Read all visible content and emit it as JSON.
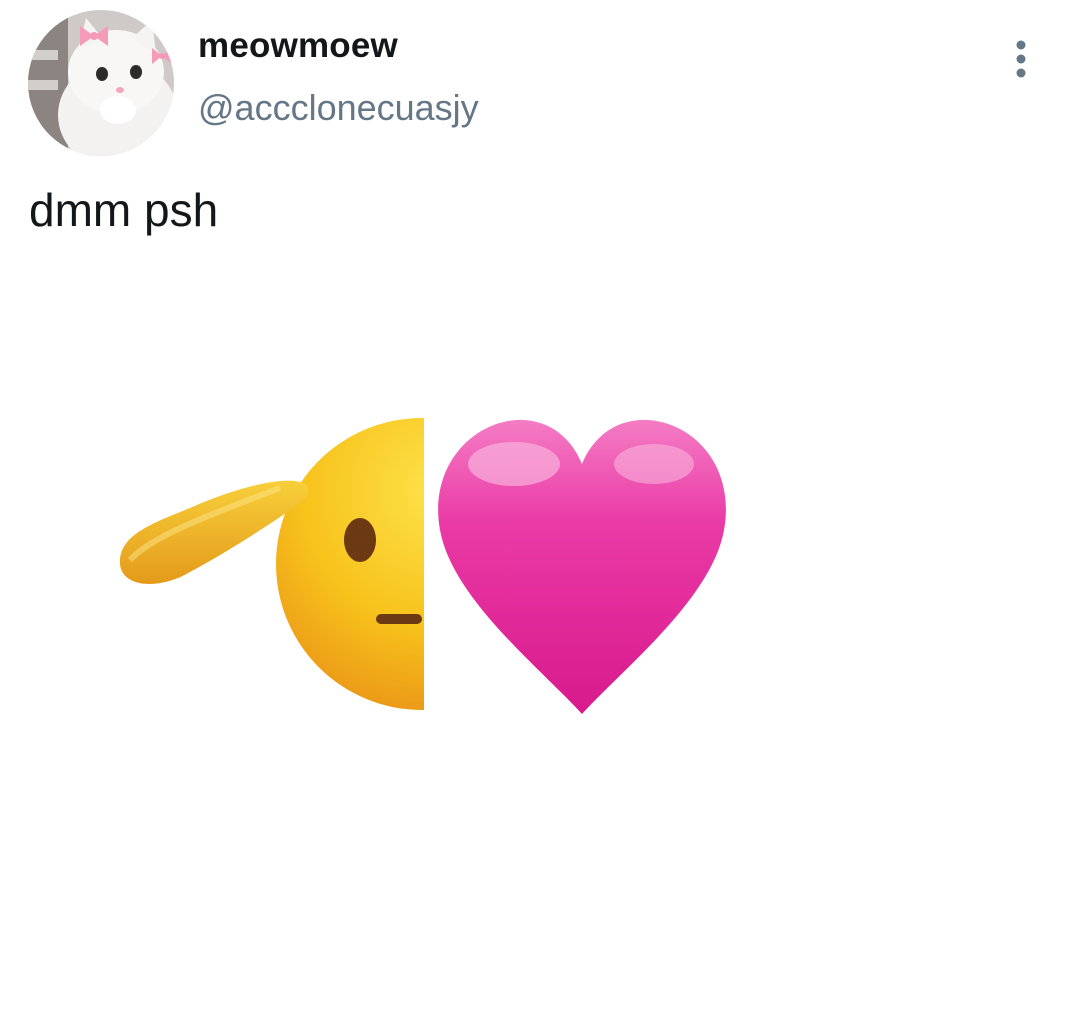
{
  "author": {
    "display_name": "meowmoew",
    "handle": "@accclonecuasjy",
    "avatar_icon": "kitten-with-pink-bows-avatar"
  },
  "actions": {
    "more_icon": "vertical-ellipsis-icon"
  },
  "tweet": {
    "text": "dmm psh"
  },
  "media": {
    "content": [
      "saluting-face-emoji-half",
      "pink-heart-emoji"
    ],
    "colors": {
      "face": "#f5c21a",
      "face_shadow": "#e8961a",
      "heart": "#e8259b",
      "heart_highlight": "#f7a8d6"
    }
  },
  "colors": {
    "name": "#14171a",
    "handle": "#657786",
    "icon": "#657786"
  }
}
